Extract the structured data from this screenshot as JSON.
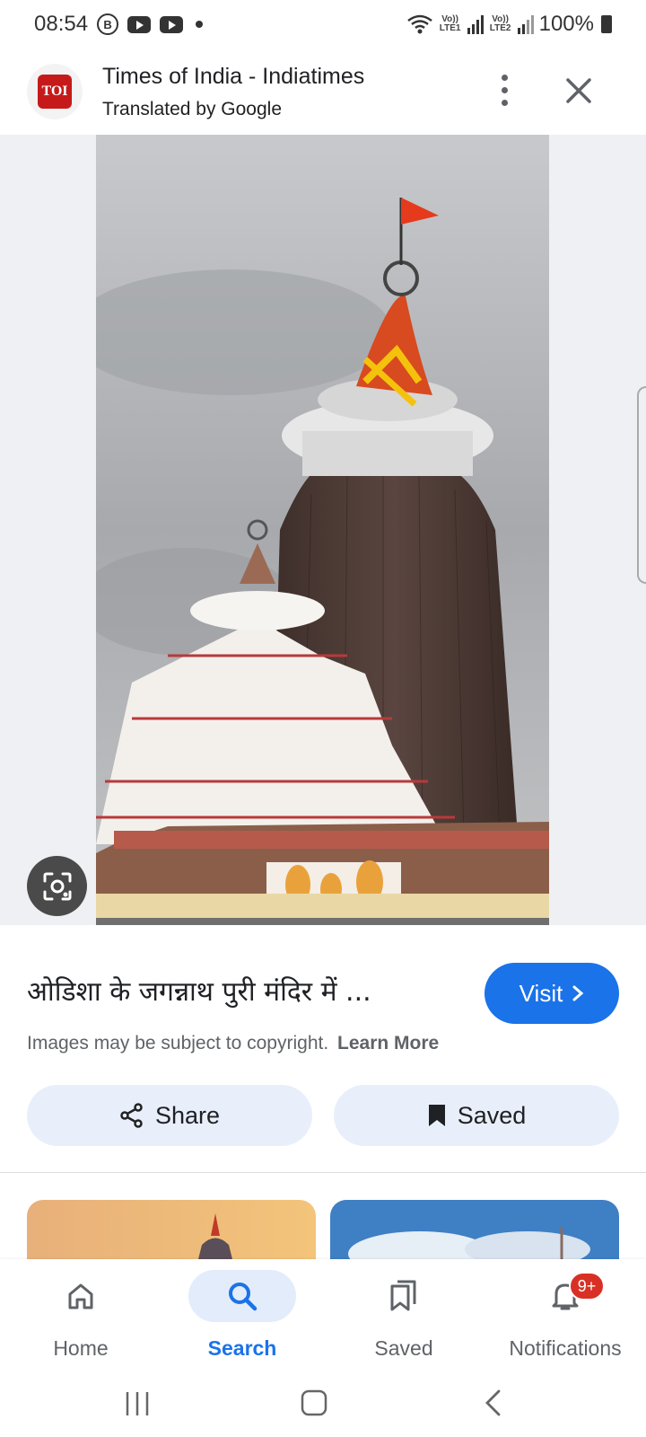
{
  "status_bar": {
    "time": "08:54",
    "battery": "100%",
    "sim1": "Vo)) LTE1",
    "sim2": "Vo)) LTE2"
  },
  "header": {
    "logo_text": "TOI",
    "site_name": "Times of India - Indiatimes",
    "subtitle": "Translated by Google"
  },
  "result": {
    "title": "ओडिशा के जगन्नाथ पुरी मंदिर में ...",
    "visit_label": "Visit",
    "copyright_text": "Images may be subject to copyright.",
    "learn_more": "Learn More",
    "share_label": "Share",
    "saved_label": "Saved"
  },
  "bottom_nav": {
    "items": [
      {
        "label": "Home"
      },
      {
        "label": "Search"
      },
      {
        "label": "Saved"
      },
      {
        "label": "Notifications"
      }
    ],
    "notification_badge": "9+"
  },
  "colors": {
    "accent": "#1a73e8",
    "button_bg": "#e8effb",
    "badge": "#d93025",
    "logo_red": "#c61a1a"
  },
  "icons": [
    "search-icon",
    "home-icon",
    "saved-icon",
    "bell-icon",
    "share-icon",
    "bookmark-icon",
    "lens-icon",
    "close-icon",
    "more-vert-icon"
  ]
}
